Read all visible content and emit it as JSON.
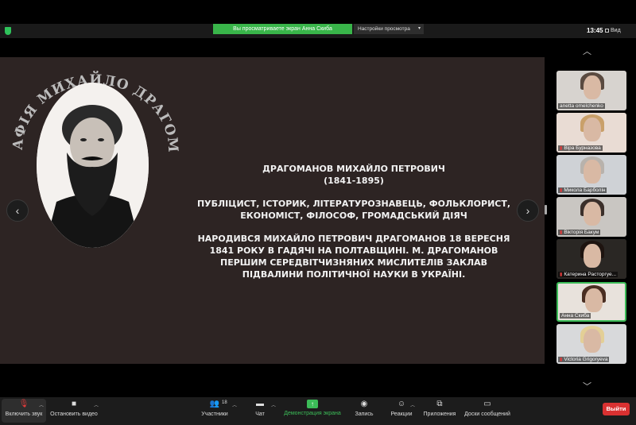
{
  "topbar": {
    "viewing_banner": "Вы просматриваете экран Анна Скиба",
    "view_settings": "Настройки просмотра",
    "clock": "13:45",
    "view_label": "Вид"
  },
  "slide": {
    "arc_title": "БІОГРАФІЯ МИХАЙЛО ДРАГОМАНОВ",
    "heading": "ДРАГОМАНОВ МИХАЙЛО ПЕТРОВИЧ\n(1841-1895)",
    "roles": "ПУБЛІЦИСТ, ІСТОРИК, ЛІТЕРАТУРОЗНАВЕЦЬ, ФОЛЬКЛОРИСТ,\nЕКОНОМІСТ, ФІЛОСОФ, ГРОМАДСЬКИЙ ДІЯЧ",
    "bio": "НАРОДИВСЯ МИХАЙЛО ПЕТРОВИЧ ДРАГОМАНОВ 18 ВЕРЕСНЯ\n1841 РОКУ В ГАДЯЧІ НА ПОЛТАВЩИНІ.  М. ДРАГОМАНОВ\nПЕРШИМ СЕРЕДВІТЧИЗНЯНИХ МИСЛИТЕЛІВ ЗАКЛАВ\nПІДВАЛИНИ ПОЛІТИЧНОЇ НАУКИ В УКРАЇНІ."
  },
  "participants": [
    {
      "name": "anetta omelchenko",
      "muted": false
    },
    {
      "name": "Віра Бурназова",
      "muted": true
    },
    {
      "name": "Микола Барболін",
      "muted": true
    },
    {
      "name": "Вікторія Бакум",
      "muted": true
    },
    {
      "name": "Катерина Расторгуе...",
      "muted": true
    },
    {
      "name": "Анна Скиба",
      "muted": false
    },
    {
      "name": "Victoria Grigoryeva",
      "muted": true
    }
  ],
  "toolbar": {
    "unmute": "Включить звук",
    "stop_video": "Остановить видео",
    "participants": "Участники",
    "participants_count": "18",
    "chat": "Чат",
    "share": "Демонстрация экрана",
    "record": "Запись",
    "reactions": "Реакции",
    "apps": "Приложения",
    "whiteboards": "Доски сообщений",
    "leave": "Выйти"
  },
  "colors": {
    "accent_green": "#3cbc58",
    "leave_red": "#d93131",
    "slide_bg": "#2d2423"
  }
}
